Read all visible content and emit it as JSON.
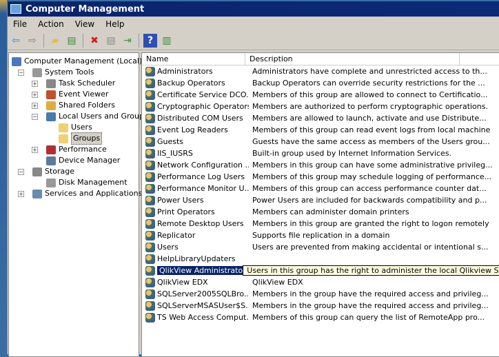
{
  "window": {
    "title": "Computer Management"
  },
  "menu": [
    "File",
    "Action",
    "View",
    "Help"
  ],
  "toolbar": [
    {
      "icon": "back-icon",
      "g": "⇦",
      "c": "#3a8ad8"
    },
    {
      "icon": "forward-icon",
      "g": "⇨",
      "c": "#888"
    },
    {
      "icon": "up-folder-icon",
      "g": "▰",
      "c": "#e0c040"
    },
    {
      "icon": "show-hide-tree-icon",
      "g": "▤",
      "c": "#3a8a3a"
    },
    {
      "icon": "delete-icon",
      "g": "✖",
      "c": "#d02020"
    },
    {
      "icon": "properties-icon",
      "g": "▤",
      "c": "#888"
    },
    {
      "icon": "export-list-icon",
      "g": "⇥",
      "c": "#3a9a3a"
    },
    {
      "icon": "help-icon",
      "g": "?",
      "c": "#fff"
    },
    {
      "icon": "show-action-pane-icon",
      "g": "▥",
      "c": "#3a8a3a"
    }
  ],
  "tree": [
    {
      "label": "Computer Management (Local)",
      "level": 0,
      "exp": "",
      "color": "#4a78c0"
    },
    {
      "label": "System Tools",
      "level": 1,
      "exp": "−",
      "color": "#999"
    },
    {
      "label": "Task Scheduler",
      "level": 2,
      "exp": "+",
      "color": "#888"
    },
    {
      "label": "Event Viewer",
      "level": 2,
      "exp": "+",
      "color": "#c05030"
    },
    {
      "label": "Shared Folders",
      "level": 2,
      "exp": "+",
      "color": "#d8b040"
    },
    {
      "label": "Local Users and Groups",
      "level": 2,
      "exp": "−",
      "color": "#4a7ab0"
    },
    {
      "label": "Users",
      "level": 3,
      "exp": "",
      "color": "#f0d070"
    },
    {
      "label": "Groups",
      "level": 3,
      "exp": "",
      "color": "#f0d070",
      "selected": true
    },
    {
      "label": "Performance",
      "level": 2,
      "exp": "+",
      "color": "#b03030"
    },
    {
      "label": "Device Manager",
      "level": 2,
      "exp": "",
      "color": "#5a7a9a"
    },
    {
      "label": "Storage",
      "level": 1,
      "exp": "−",
      "color": "#888"
    },
    {
      "label": "Disk Management",
      "level": 2,
      "exp": "",
      "color": "#999"
    },
    {
      "label": "Services and Applications",
      "level": 1,
      "exp": "+",
      "color": "#6a8ab0"
    }
  ],
  "list": {
    "columns": [
      "Name",
      "Description"
    ],
    "rows": [
      [
        "Administrators",
        "Administrators have complete and unrestricted access to th..."
      ],
      [
        "Backup Operators",
        "Backup Operators can override security restrictions for the ..."
      ],
      [
        "Certificate Service DCO...",
        "Members of this group are allowed to connect to Certificatio..."
      ],
      [
        "Cryptographic Operators",
        "Members are authorized to perform cryptographic operations."
      ],
      [
        "Distributed COM Users",
        "Members are allowed to launch, activate and use Distribute..."
      ],
      [
        "Event Log Readers",
        "Members of this group can read event logs from local machine"
      ],
      [
        "Guests",
        "Guests have the same access as members of the Users grou..."
      ],
      [
        "IIS_IUSRS",
        "Built-in group used by Internet Information Services."
      ],
      [
        "Network Configuration ...",
        "Members in this group can have some administrative privileg..."
      ],
      [
        "Performance Log Users",
        "Members of this group may schedule logging of performance..."
      ],
      [
        "Performance Monitor U...",
        "Members of this group can access performance counter dat..."
      ],
      [
        "Power Users",
        "Power Users are included for backwards compatibility and p..."
      ],
      [
        "Print Operators",
        "Members can administer domain printers"
      ],
      [
        "Remote Desktop Users",
        "Members in this group are granted the right to logon remotely"
      ],
      [
        "Replicator",
        "Supports file replication in a domain"
      ],
      [
        "Users",
        "Users are prevented from making accidental or intentional s..."
      ],
      [
        "HelpLibraryUpdaters",
        ""
      ],
      [
        "QlikView Administrators",
        "Users in this group has the right to administer the local Qlikview Server and I"
      ],
      [
        "QlikView EDX",
        "QlikView EDX"
      ],
      [
        "SQLServer2005SQLBro...",
        "Members in the group have the required access and privileg..."
      ],
      [
        "SQLServerMSASUser$S...",
        "Members in the group have the required access and privileg..."
      ],
      [
        "TS Web Access Comput...",
        "Members of this group can query the list of RemoteApp pro..."
      ]
    ],
    "selected_index": 17
  }
}
